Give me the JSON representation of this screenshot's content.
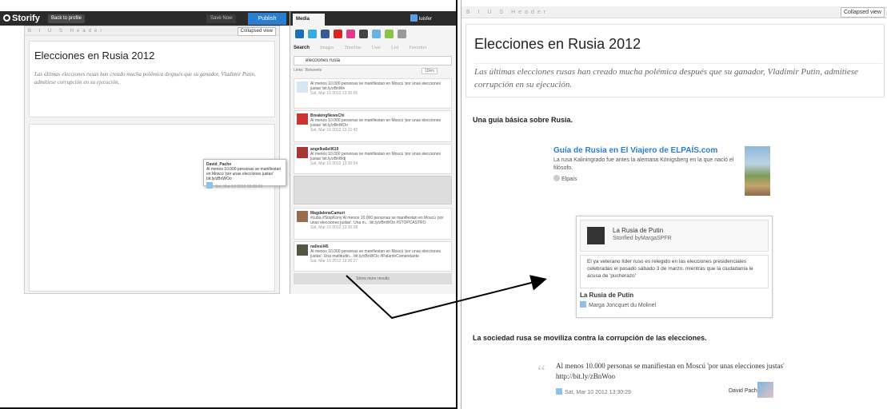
{
  "left_app": {
    "brand": "Storify",
    "back_label": "Back to profile",
    "save_now": "Save Now",
    "publish": "Publish",
    "toolbar": "B I U S Header",
    "collapsed": "Collapsed view",
    "story_title": "Elecciones en Rusia 2012",
    "story_desc": "Las últimas elecciones rusas han creado mucha polémica después que su ganador, Vladimir Putin, admitiese corrupción en su ejecución."
  },
  "dragged": {
    "name": "David_Pache",
    "text": "Al menos 10.000 personas se manifiestan en Moscú 'por unas elecciones justas' bit.ly/zBnWOo",
    "date": "Sat, Mar 10 2012 13:30:29"
  },
  "media": {
    "tab": "Media",
    "user": "luisfer",
    "tabs": [
      "Search",
      "Images",
      "Timeline",
      "User",
      "List",
      "Favorites"
    ],
    "query": "elecciones rusia",
    "filter_a": "Links",
    "filter_b": "Retweets",
    "radius": "10km",
    "show_more": "Show more results",
    "results": [
      {
        "name": "",
        "text": "Al menos 10.000 personas se manifiestan en Moscú 'por unas elecciones justas' bit.ly/zBnWe",
        "date": "Sat, Mar 10 2012 13:30:05"
      },
      {
        "name": "BreakingNewsChi",
        "text": "Al menos 10.000 personas se manifiestan en Moscú 'por unas elecciones justas' bit.ly/zBnWOo",
        "date": "Sat, Mar 10 2012 13:31:42"
      },
      {
        "name": "angelka6ell619",
        "text": "Al menos 10.000 personas se manifiestan en Moscú 'por unas elecciones justas' bit.ly/zBnWdj",
        "date": "Sat, Mar 10 2012 13:30:54"
      },
      {
        "name": "MagdalenaCamuri",
        "text": "#cuba #StopKony Al menos 10.000 personas se manifiestan en Moscú 'por unas elecciones justas': Una m... bit.ly/zBnWOo #STOPCASTRO",
        "date": "Sat, Mar 10 2012 13:30:28"
      },
      {
        "name": "nallesil45",
        "text": "Al menos 10.000 personas se manifiestan en Moscú 'por unas elecciones justas': Una multitudin... bit.ly/zBnWOo #PalanteComandante",
        "date": "Sat, Mar 10 2012 13:30:27"
      }
    ]
  },
  "right_app": {
    "toolbar": "B I U S Header",
    "collapsed": "Collapsed view",
    "title": "Elecciones en Rusia 2012",
    "desc": "Las últimas elecciones rusas han creado mucha polémica después que su ganador, Vladimir Putin, admitiese corrupción en su ejecución.",
    "heading1": "Una guía básica sobre Rusia.",
    "link_title": "Guía de Rusia en El Viajero de ELPAÍS.com",
    "link_desc": "La rusa Kaliningrado fue antes la alemana Königsberg en la que nació el filósofo.",
    "link_source": "Elpaís",
    "embed_title": "La Rusia de Putin",
    "embed_by": "Storified byMargaSPFR",
    "embed_text": "El ya veterano líder ruso es relegido en las elecciones presidenciales celebradas el pasado sábado 3 de marzo, mientras que la ciudadanía le acusa de 'pucherazo'",
    "embed_name": "La Rusia de Putin",
    "embed_source": "Marga Joncquet du Molinel",
    "heading2": "La sociedad rusa se moviliza contra la corrupción de las elecciones.",
    "tweet_text": "Al menos 10.000 personas se manifiestan en Moscú 'por unas elecciones justas' http://bit.ly/zBnWoo",
    "tweet_date": "Sat, Mar 10 2012 13:30:29",
    "tweet_author": "David Pache ✔"
  }
}
